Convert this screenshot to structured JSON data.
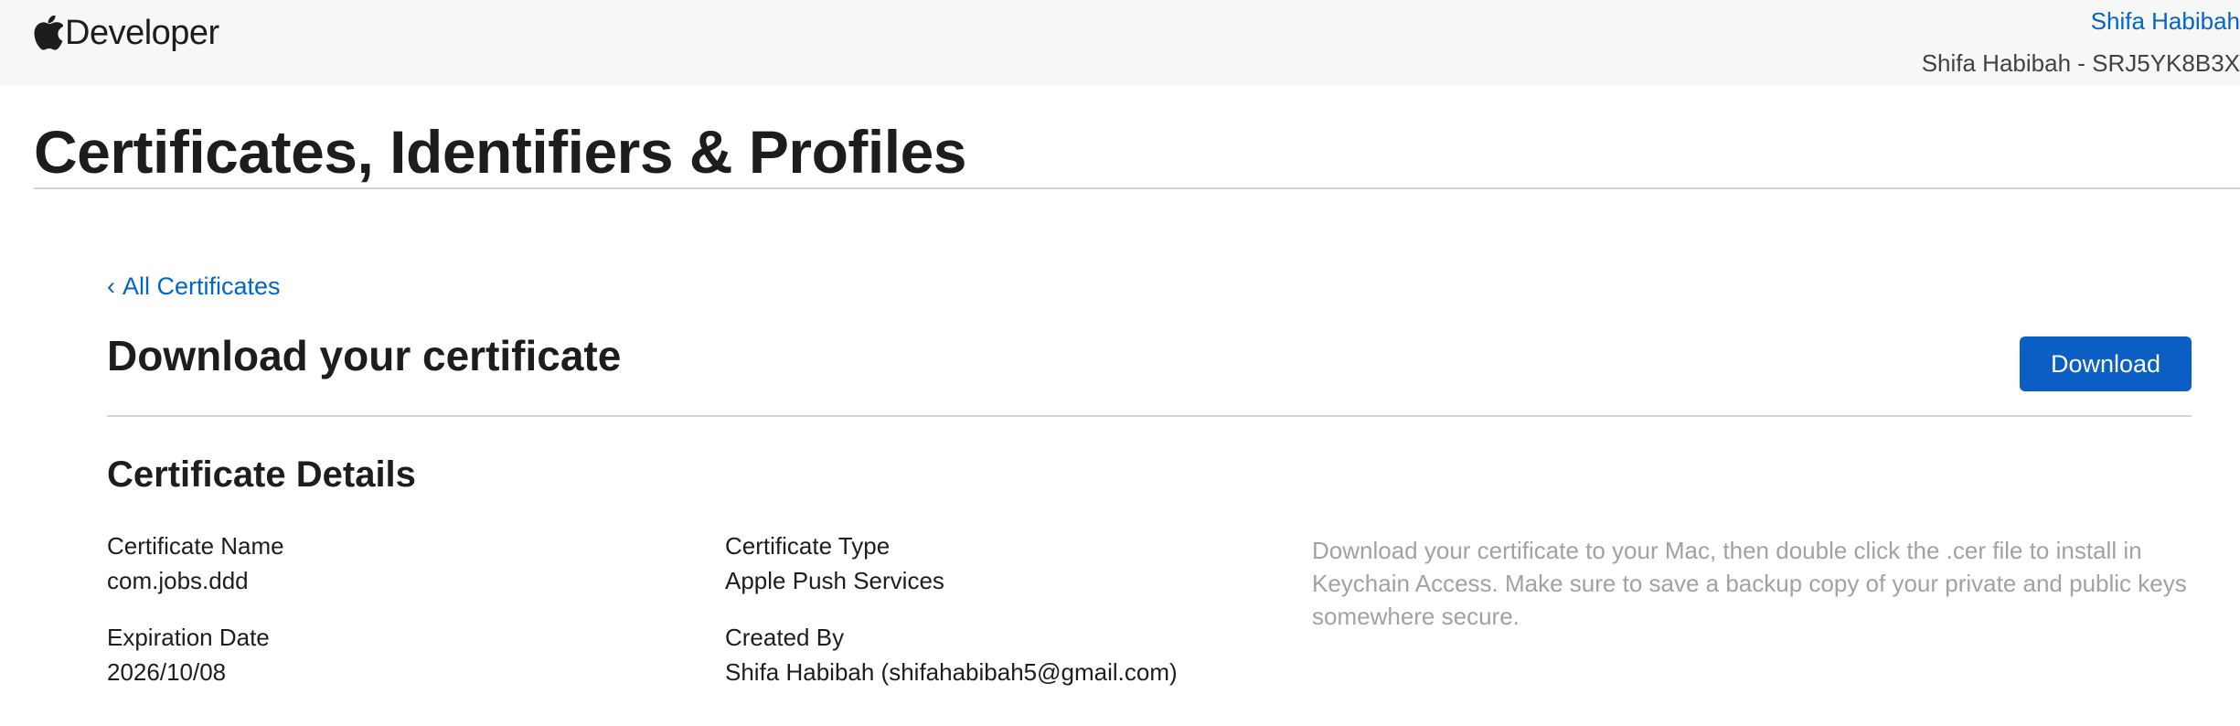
{
  "header": {
    "brand_label": "Developer",
    "account_name": "Shifa Habibah",
    "account_team": "Shifa Habibah - SRJ5YK8B3X"
  },
  "page": {
    "title": "Certificates, Identifiers & Profiles"
  },
  "breadcrumb": {
    "chevron": "‹",
    "back_label": "All Certificates"
  },
  "section": {
    "title": "Download your certificate",
    "download_label": "Download"
  },
  "details": {
    "title": "Certificate Details",
    "fields": [
      {
        "label": "Certificate Name",
        "value": "com.jobs.ddd"
      },
      {
        "label": "Certificate Type",
        "value": "Apple Push Services"
      },
      {
        "label": "Expiration Date",
        "value": "2026/10/08"
      },
      {
        "label": "Created By",
        "value": "Shifa Habibah (shifahabibah5@gmail.com)"
      }
    ],
    "help_text": "Download your certificate to your Mac, then double click the .cer file to install in Keychain Access. Make sure to save a backup copy of your private and public keys somewhere secure."
  },
  "colors": {
    "link": "#0066cc",
    "button": "#0a5ec4",
    "muted_text": "#a1a1a6",
    "topbar": "#f7f7f7"
  },
  "icons": {
    "brand": "apple-logo-icon",
    "back": "chevron-left-icon"
  }
}
